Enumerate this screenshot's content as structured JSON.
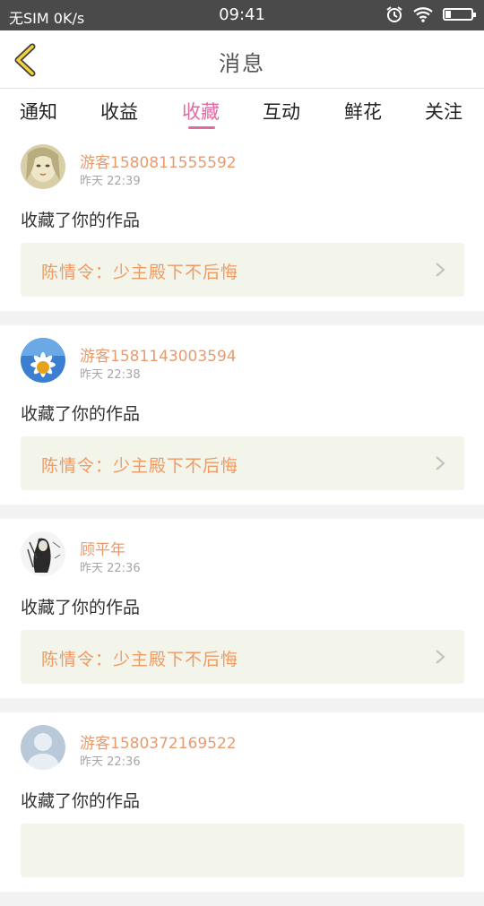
{
  "status_bar": {
    "carrier": "无SIM 0K/s",
    "time": "09:41"
  },
  "header": {
    "title": "消息"
  },
  "tabs": [
    {
      "label": "通知"
    },
    {
      "label": "收益"
    },
    {
      "label": "收藏"
    },
    {
      "label": "互动"
    },
    {
      "label": "鲜花"
    },
    {
      "label": "关注"
    }
  ],
  "active_tab": "收藏",
  "colors": {
    "accent": "#e06aa1",
    "username": "#e99b6c",
    "work_title": "#f09a63",
    "work_bg": "#f3f4ea"
  },
  "messages": [
    {
      "username": "游客1580811555592",
      "time": "昨天 22:39",
      "action": "收藏了你的作品",
      "work": "陈情令：少主殿下不后悔",
      "avatar": "girl-avatar-icon"
    },
    {
      "username": "游客1581143003594",
      "time": "昨天 22:38",
      "action": "收藏了你的作品",
      "work": "陈情令：少主殿下不后悔",
      "avatar": "daisy-avatar-icon"
    },
    {
      "username": "顾平年",
      "time": "昨天 22:36",
      "action": "收藏了你的作品",
      "work": "陈情令：少主殿下不后悔",
      "avatar": "ink-figure-avatar-icon"
    },
    {
      "username": "游客1580372169522",
      "time": "昨天 22:36",
      "action": "收藏了你的作品",
      "work": "",
      "avatar": "default-user-avatar-icon"
    }
  ]
}
